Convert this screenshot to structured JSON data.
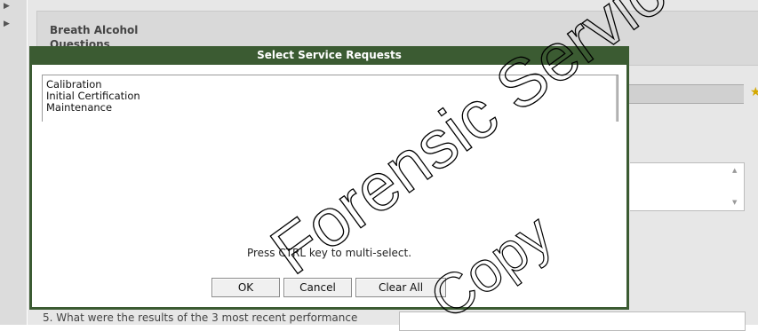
{
  "app": {
    "header_title": "Breath Alcohol Questions",
    "question_label": "5.  What were the results of the 3 most recent performance"
  },
  "dialog": {
    "title": "Select Service Requests",
    "options": [
      "Calibration",
      "Initial Certification",
      "Maintenance"
    ],
    "hint": "Press CTRL key to multi-select.",
    "buttons": {
      "ok": "OK",
      "cancel": "Cancel",
      "clear_all": "Clear All"
    }
  },
  "watermark": {
    "line1": "Forensic Services",
    "line2": "Copy"
  },
  "colors": {
    "dialog_frame": "#3b5b32",
    "background": "#e7e7e7"
  }
}
